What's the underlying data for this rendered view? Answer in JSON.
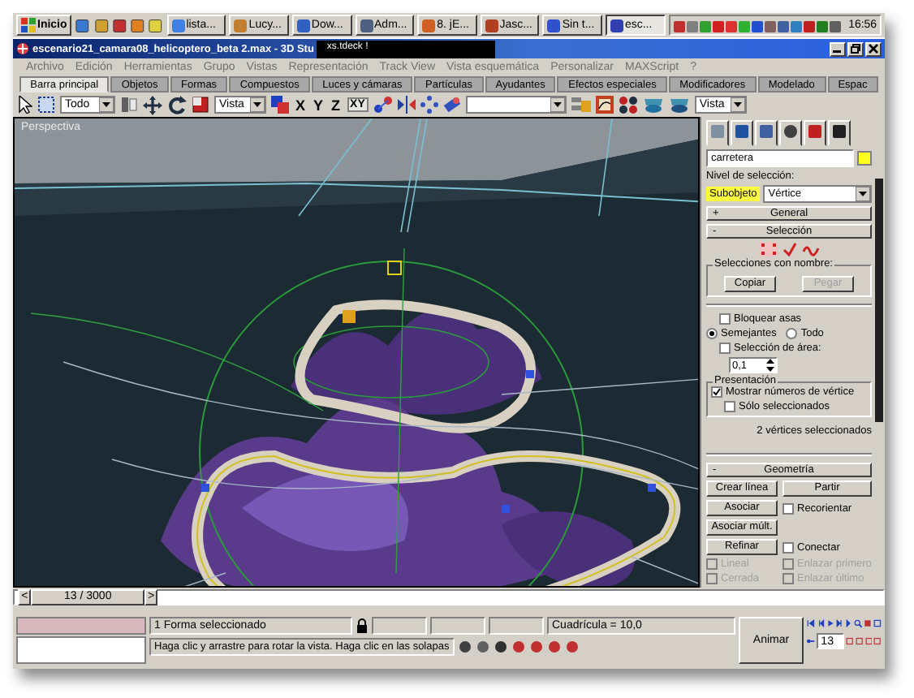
{
  "taskbar": {
    "start": "Inicio",
    "tasks": [
      {
        "label": "lista...",
        "selected": false
      },
      {
        "label": "Lucy...",
        "selected": false
      },
      {
        "label": "Dow...",
        "selected": false
      },
      {
        "label": "Adm...",
        "selected": false
      },
      {
        "label": "8. jE...",
        "selected": false
      },
      {
        "label": "Jasc...",
        "selected": false
      },
      {
        "label": "Sin t...",
        "selected": false
      },
      {
        "label": "esc...",
        "selected": true
      }
    ],
    "clock": "16:56"
  },
  "window": {
    "title": "escenario21_camara08_helicoptero_beta 2.max - 3D Stu",
    "overlay_title": "xs.tdeck !"
  },
  "menu": [
    {
      "label": "Archivo",
      "disabled": true
    },
    {
      "label": "Edición",
      "disabled": true
    },
    {
      "label": "Herramientas",
      "disabled": true
    },
    {
      "label": "Grupo",
      "disabled": true
    },
    {
      "label": "Vistas",
      "disabled": true
    },
    {
      "label": "Representación",
      "disabled": true
    },
    {
      "label": "Track View",
      "disabled": true
    },
    {
      "label": "Vista esquemática",
      "disabled": true
    },
    {
      "label": "Personalizar",
      "disabled": true
    },
    {
      "label": "MAXScript",
      "disabled": true
    },
    {
      "label": "?",
      "disabled": true
    }
  ],
  "tabs": [
    {
      "label": "Barra principal",
      "selected": true
    },
    {
      "label": "Objetos",
      "selected": false
    },
    {
      "label": "Formas",
      "selected": false
    },
    {
      "label": "Compuestos",
      "selected": false
    },
    {
      "label": "Luces y cámaras",
      "selected": false
    },
    {
      "label": "Partículas",
      "selected": false
    },
    {
      "label": "Ayudantes",
      "selected": false
    },
    {
      "label": "Efectos especiales",
      "selected": false
    },
    {
      "label": "Modificadores",
      "selected": false
    },
    {
      "label": "Modelado",
      "selected": false
    },
    {
      "label": "Espac",
      "selected": false
    }
  ],
  "toolbar": {
    "selection_filter": "Todo",
    "reference_coord": "Vista",
    "axes": [
      "X",
      "Y",
      "Z",
      "XY"
    ],
    "render_view": "Vista"
  },
  "viewport": {
    "label": "Perspectiva"
  },
  "command_panel": {
    "object_name": "carretera",
    "selection_level_label": "Nivel de selección:",
    "subobject": "Subobjeto",
    "subobject_mode": "Vértice",
    "rollouts": [
      {
        "sign": "+",
        "title": "General"
      },
      {
        "sign": "-",
        "title": "Selección"
      }
    ],
    "named_selections": {
      "title": "Selecciones con nombre:",
      "buttons": [
        {
          "label": "Copiar",
          "disabled": false
        },
        {
          "label": "Pegar",
          "disabled": true
        }
      ]
    },
    "lock_handles": {
      "label": "Bloquear asas",
      "checked": false
    },
    "handle_mode": [
      {
        "label": "Semejantes",
        "selected": true
      },
      {
        "label": "Todo",
        "selected": false
      }
    ],
    "area_selection": {
      "label": "Selección de área:",
      "checked": false,
      "value": "0,1"
    },
    "display": {
      "title": "Presentación",
      "options": [
        {
          "label": "Mostrar números de vértice",
          "checked": true
        },
        {
          "label": "Sólo seleccionados",
          "checked": false
        }
      ]
    },
    "selection_status": "2 vértices seleccionados",
    "geometry": {
      "sign": "-",
      "title": "Geometría",
      "rows": [
        [
          {
            "kind": "button",
            "label": "Crear línea"
          },
          {
            "kind": "button",
            "label": "Partir"
          }
        ],
        [
          {
            "kind": "button",
            "label": "Asociar"
          },
          {
            "kind": "checkbox",
            "label": "Recorientar",
            "checked": false,
            "disabled": false
          }
        ],
        [
          {
            "kind": "button",
            "label": "Asociar múlt."
          }
        ],
        [
          {
            "kind": "button",
            "label": "Refinar"
          },
          {
            "kind": "checkbox",
            "label": "Conectar",
            "checked": false,
            "disabled": false
          }
        ],
        [
          {
            "kind": "checkbox",
            "label": "Lineal",
            "checked": false,
            "disabled": true
          },
          {
            "kind": "checkbox",
            "label": "Enlazar primero",
            "checked": false,
            "disabled": true
          }
        ],
        [
          {
            "kind": "checkbox",
            "label": "Cerrada",
            "checked": false,
            "disabled": true
          },
          {
            "kind": "checkbox",
            "label": "Enlazar último",
            "checked": false,
            "disabled": true
          }
        ]
      ]
    }
  },
  "time_slider": {
    "prev": "<",
    "frame": "13 / 3000",
    "next": ">",
    "level": 0.004
  },
  "status_bar": {
    "selection": "1 Forma seleccionado",
    "grid": "Cuadrícula = 10,0",
    "prompt": "Haga clic y arrastre para rotar la vista. Haga clic en las solapas",
    "animate": "Animar",
    "frame": "13"
  }
}
